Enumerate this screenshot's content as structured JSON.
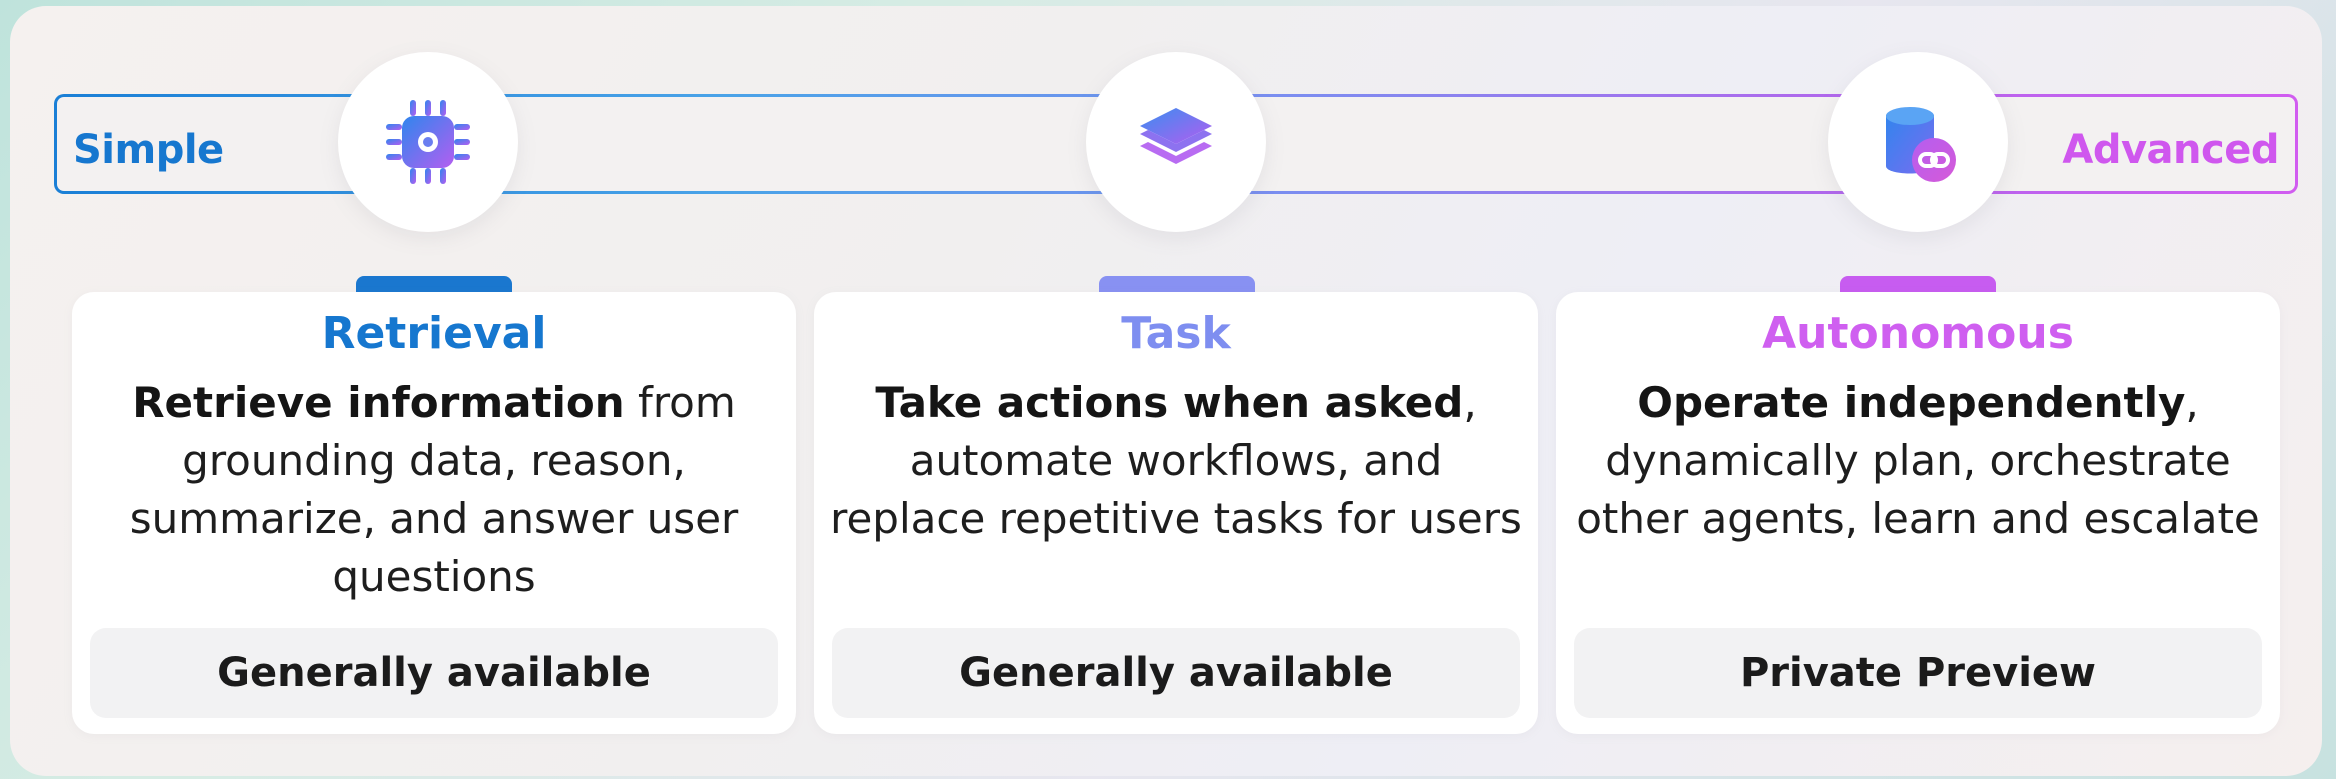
{
  "scale": {
    "start_label": "Simple",
    "end_label": "Advanced"
  },
  "colors": {
    "retrieval": "#1677cf",
    "task": "#7e8ef0",
    "autonomous": "#cf5ff0"
  },
  "cards": [
    {
      "icon": "chip-icon",
      "title": "Retrieval",
      "desc_bold": "Retrieve information",
      "desc_rest": " from grounding data, reason, summarize, and answer user questions",
      "status": "Generally available"
    },
    {
      "icon": "layers-icon",
      "title": "Task",
      "desc_bold": "Take actions when asked",
      "desc_rest": ", automate workflows, and replace repetitive tasks for users",
      "status": "Generally available"
    },
    {
      "icon": "database-link-icon",
      "title": "Autonomous",
      "desc_bold": "Operate independently",
      "desc_rest": ", dynamically plan, orchestrate other agents, learn and escalate",
      "status": "Private Preview"
    }
  ]
}
